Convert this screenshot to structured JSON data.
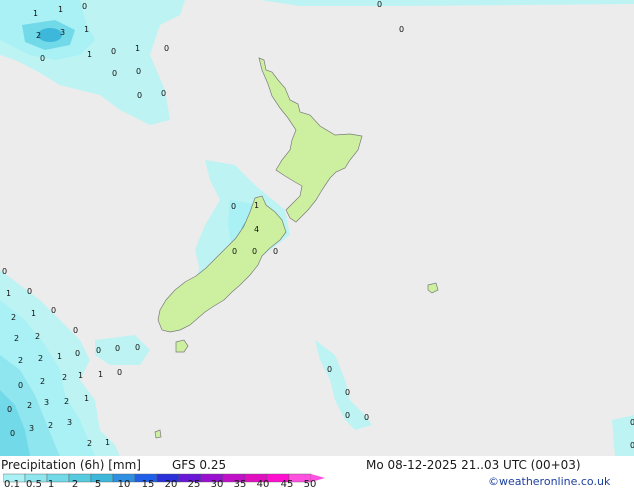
{
  "product_title": "Precipitation (6h) [mm]",
  "model": "GFS 0.25",
  "valid_time": "Mo 08-12-2025 21..03 UTC (00+03)",
  "credit": "©weatheronline.co.uk",
  "legend": {
    "ticks": [
      "0.1",
      "0.5",
      "1",
      "2",
      "5",
      "10",
      "15",
      "20",
      "25",
      "30",
      "35",
      "40",
      "45",
      "50"
    ],
    "colors": [
      "#a9f1f5",
      "#8fe6ef",
      "#72d9e8",
      "#56cbe0",
      "#3eb8da",
      "#2f8fe0",
      "#2060e8",
      "#2b30d8",
      "#6a18d8",
      "#9a10d0",
      "#c010c8",
      "#e010c0",
      "#ff10d0",
      "#ff50e0"
    ]
  },
  "map_labels": [
    {
      "text": "1"
    },
    {
      "text": "1"
    },
    {
      "text": "0"
    },
    {
      "text": "2"
    },
    {
      "text": "3"
    },
    {
      "text": "1"
    },
    {
      "text": "0"
    },
    {
      "text": "1"
    },
    {
      "text": "0"
    },
    {
      "text": "1"
    },
    {
      "text": "0"
    },
    {
      "text": "0"
    },
    {
      "text": "0"
    },
    {
      "text": "0"
    },
    {
      "text": "0"
    },
    {
      "text": "0"
    },
    {
      "text": "0"
    },
    {
      "text": "1"
    },
    {
      "text": "4"
    },
    {
      "text": "0"
    },
    {
      "text": "0"
    },
    {
      "text": "0"
    },
    {
      "text": "0"
    },
    {
      "text": "1"
    },
    {
      "text": "0"
    },
    {
      "text": "2"
    },
    {
      "text": "1"
    },
    {
      "text": "0"
    },
    {
      "text": "0"
    },
    {
      "text": "2"
    },
    {
      "text": "2"
    },
    {
      "text": "1"
    },
    {
      "text": "0"
    },
    {
      "text": "0"
    },
    {
      "text": "0"
    },
    {
      "text": "0"
    },
    {
      "text": "0"
    },
    {
      "text": "2"
    },
    {
      "text": "2"
    },
    {
      "text": "1"
    },
    {
      "text": "0"
    },
    {
      "text": "0"
    },
    {
      "text": "2"
    },
    {
      "text": "2"
    },
    {
      "text": "1"
    },
    {
      "text": "0"
    },
    {
      "text": "2"
    },
    {
      "text": "3"
    },
    {
      "text": "2"
    },
    {
      "text": "1"
    },
    {
      "text": "0"
    },
    {
      "text": "3"
    },
    {
      "text": "2"
    },
    {
      "text": "3"
    },
    {
      "text": "2"
    },
    {
      "text": "1"
    },
    {
      "text": "0"
    },
    {
      "text": "0"
    },
    {
      "text": "0"
    },
    {
      "text": "0"
    },
    {
      "text": "0"
    },
    {
      "text": "0"
    }
  ]
}
